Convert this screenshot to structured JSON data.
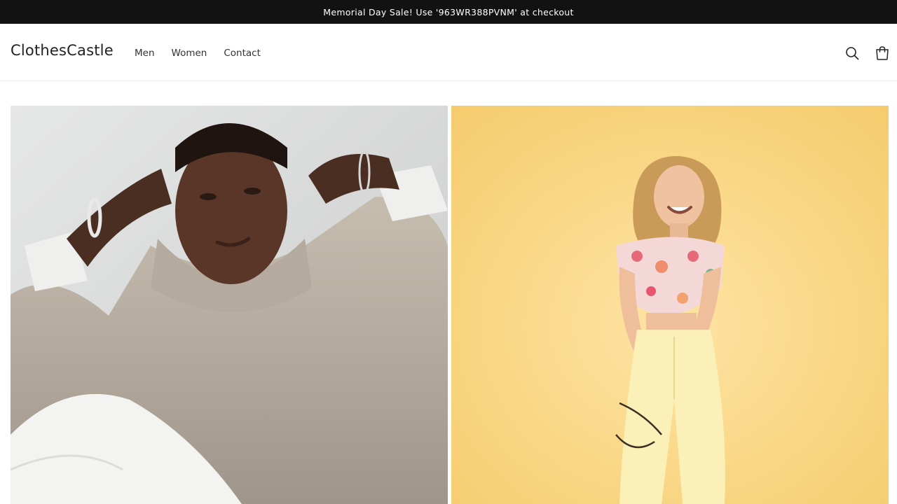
{
  "announcement": {
    "text": "Memorial Day Sale! Use '963WR388PVNM' at checkout"
  },
  "header": {
    "logo": "ClothesCastle",
    "nav": [
      {
        "label": "Men"
      },
      {
        "label": "Women"
      },
      {
        "label": "Contact"
      }
    ],
    "icons": {
      "search": "search-icon",
      "cart": "cart-icon"
    }
  },
  "hero": {
    "tiles": [
      {
        "subject": "men",
        "background": "#d8d9d9"
      },
      {
        "subject": "women",
        "background": "#f6cd6f"
      }
    ]
  },
  "colors": {
    "announcement_bg": "#121212",
    "announcement_text": "#ffffff",
    "page_bg": "#ffffff",
    "text": "#121212"
  }
}
